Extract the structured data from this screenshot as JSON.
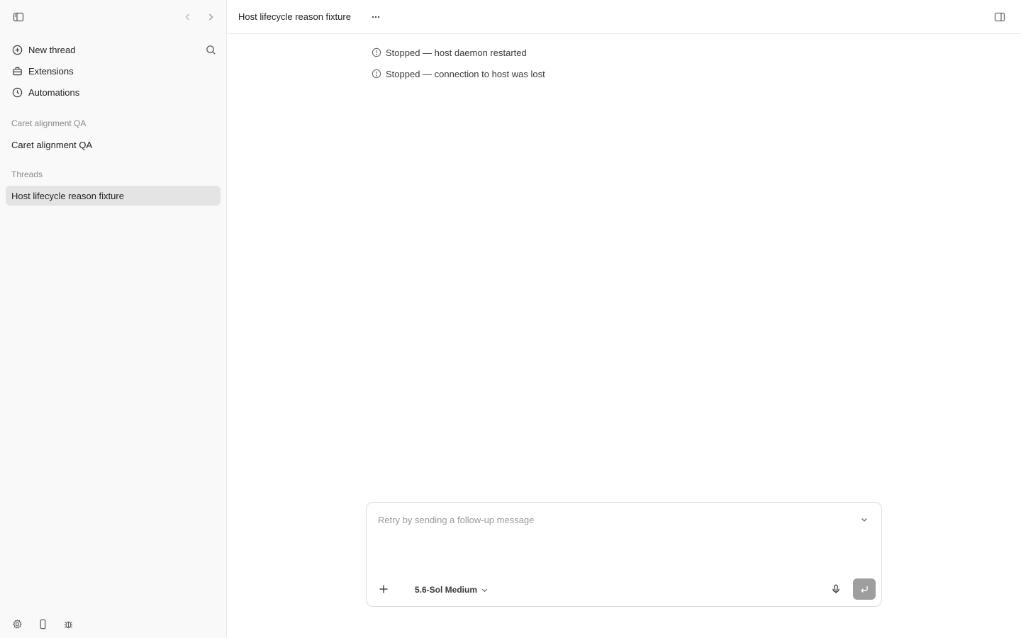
{
  "sidebar": {
    "nav": [
      {
        "label": "New thread",
        "icon": "plus-circle-icon"
      },
      {
        "label": "Extensions",
        "icon": "toolbox-icon"
      },
      {
        "label": "Automations",
        "icon": "clock-icon"
      }
    ],
    "projects_heading": "Caret alignment QA",
    "projects": [
      {
        "label": "Caret alignment QA"
      }
    ],
    "threads_heading": "Threads",
    "threads": [
      {
        "label": "Host lifecycle reason fixture",
        "active": true
      }
    ]
  },
  "header": {
    "title": "Host lifecycle reason fixture"
  },
  "messages": [
    {
      "text": "Stopped — host daemon restarted",
      "icon": "info-circle-icon"
    },
    {
      "text": "Stopped — connection to host was lost",
      "icon": "info-circle-icon"
    }
  ],
  "composer": {
    "placeholder": "Retry by sending a follow-up message",
    "model": "5.6-Sol Medium"
  },
  "colors": {
    "sidebar_bg": "#f9f9f9",
    "active_item_bg": "#e4e4e4",
    "send_button_bg": "#9e9e9e"
  }
}
